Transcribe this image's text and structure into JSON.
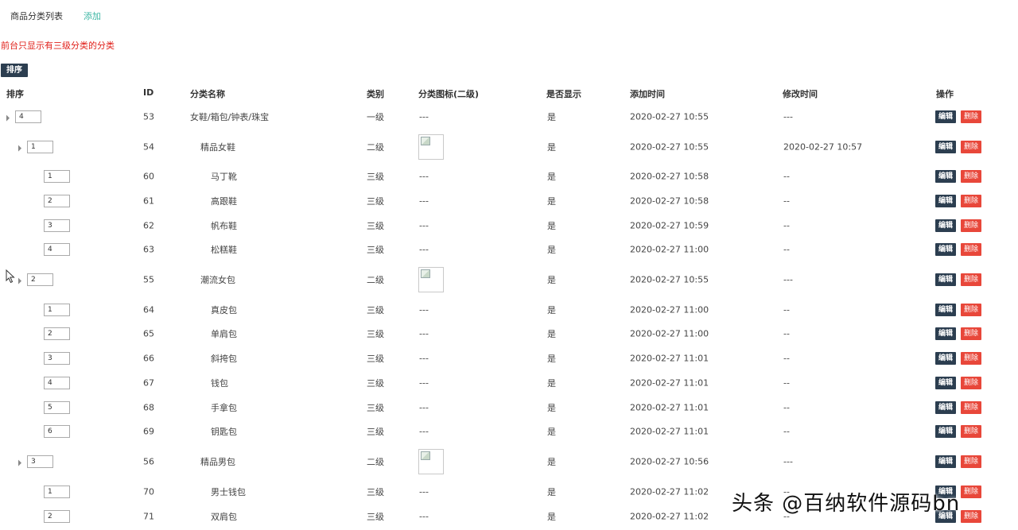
{
  "tabs": {
    "list": "商品分类列表",
    "add": "添加"
  },
  "notice": "前台只显示有三级分类的分类",
  "sort_button": "排序",
  "headers": [
    "排序",
    "ID",
    "分类名称",
    "类别",
    "分类图标(二级)",
    "是否显示",
    "添加时间",
    "修改时间",
    "操作"
  ],
  "actions": {
    "edit": "编辑",
    "delete": "删除"
  },
  "rows": [
    {
      "sort": "4",
      "id": "53",
      "name": "女鞋/箱包/钟表/珠宝",
      "level": "一级",
      "icon": "---",
      "show": "是",
      "added": "2020-02-27 10:55",
      "modified": "---"
    },
    {
      "sort": "1",
      "id": "54",
      "name": "精品女鞋",
      "level": "二级",
      "icon": "img",
      "show": "是",
      "added": "2020-02-27 10:55",
      "modified": "2020-02-27 10:57"
    },
    {
      "sort": "1",
      "id": "60",
      "name": "马丁靴",
      "level": "三级",
      "icon": "---",
      "show": "是",
      "added": "2020-02-27 10:58",
      "modified": "--"
    },
    {
      "sort": "2",
      "id": "61",
      "name": "高跟鞋",
      "level": "三级",
      "icon": "---",
      "show": "是",
      "added": "2020-02-27 10:58",
      "modified": "--"
    },
    {
      "sort": "3",
      "id": "62",
      "name": "帆布鞋",
      "level": "三级",
      "icon": "---",
      "show": "是",
      "added": "2020-02-27 10:59",
      "modified": "--"
    },
    {
      "sort": "4",
      "id": "63",
      "name": "松糕鞋",
      "level": "三级",
      "icon": "---",
      "show": "是",
      "added": "2020-02-27 11:00",
      "modified": "--"
    },
    {
      "sort": "2",
      "id": "55",
      "name": "潮流女包",
      "level": "二级",
      "icon": "img",
      "show": "是",
      "added": "2020-02-27 10:55",
      "modified": "---"
    },
    {
      "sort": "1",
      "id": "64",
      "name": "真皮包",
      "level": "三级",
      "icon": "---",
      "show": "是",
      "added": "2020-02-27 11:00",
      "modified": "--"
    },
    {
      "sort": "2",
      "id": "65",
      "name": "单肩包",
      "level": "三级",
      "icon": "---",
      "show": "是",
      "added": "2020-02-27 11:00",
      "modified": "--"
    },
    {
      "sort": "3",
      "id": "66",
      "name": "斜挎包",
      "level": "三级",
      "icon": "---",
      "show": "是",
      "added": "2020-02-27 11:01",
      "modified": "--"
    },
    {
      "sort": "4",
      "id": "67",
      "name": "钱包",
      "level": "三级",
      "icon": "---",
      "show": "是",
      "added": "2020-02-27 11:01",
      "modified": "--"
    },
    {
      "sort": "5",
      "id": "68",
      "name": "手拿包",
      "level": "三级",
      "icon": "---",
      "show": "是",
      "added": "2020-02-27 11:01",
      "modified": "--"
    },
    {
      "sort": "6",
      "id": "69",
      "name": "钥匙包",
      "level": "三级",
      "icon": "---",
      "show": "是",
      "added": "2020-02-27 11:01",
      "modified": "--"
    },
    {
      "sort": "3",
      "id": "56",
      "name": "精品男包",
      "level": "二级",
      "icon": "img",
      "show": "是",
      "added": "2020-02-27 10:56",
      "modified": "---"
    },
    {
      "sort": "1",
      "id": "70",
      "name": "男士钱包",
      "level": "三级",
      "icon": "---",
      "show": "是",
      "added": "2020-02-27 11:02",
      "modified": "--"
    },
    {
      "sort": "2",
      "id": "71",
      "name": "双肩包",
      "level": "三级",
      "icon": "---",
      "show": "是",
      "added": "2020-02-27 11:02",
      "modified": "--"
    }
  ],
  "watermark": "头条 @百纳软件源码bn",
  "colors": {
    "accent_dark": "#2c3e50",
    "danger": "#e8473a",
    "notice": "#e0201a",
    "link": "#3cb6a4"
  },
  "icons": {
    "row_expand": "caret-right-icon",
    "broken_image": "broken-image-icon",
    "cursor": "mouse-cursor-icon"
  }
}
